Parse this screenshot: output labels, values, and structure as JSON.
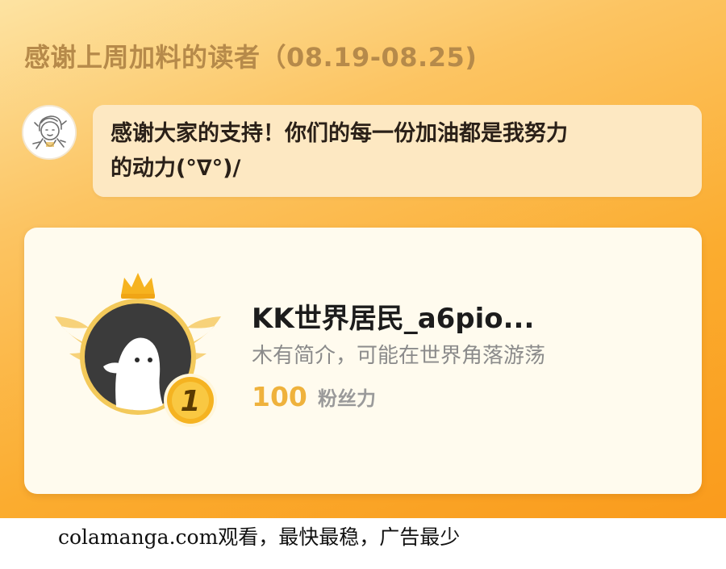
{
  "header": {
    "title": "感谢上周加料的读者（08.19-08.25)"
  },
  "message": {
    "text": "感谢大家的支持！你们的每一份加油都是我努力\n的动力(°∇°)/"
  },
  "reader": {
    "name": "KK世界居民_a6pio...",
    "bio": "木有简介，可能在世界角落游荡",
    "rank": "1",
    "fan_power_value": "100",
    "fan_power_label": "粉丝力"
  },
  "watermark": {
    "text": "colamanga.com观看，最快最稳，广告最少"
  },
  "colors": {
    "panel_orange": "#fbac2f",
    "title_brown": "#b68a4a",
    "bubble": "#fde8c2",
    "card": "#fffbee",
    "gold": "#f6b31f",
    "fan_value": "#efb23c"
  },
  "icons": {
    "author_avatar": "sketch-character-avatar",
    "reader_avatar": "ghost-mascot-avatar",
    "crown": "crown-icon",
    "wings": "wings-icon",
    "rank_badge": "gold-medal-icon"
  }
}
